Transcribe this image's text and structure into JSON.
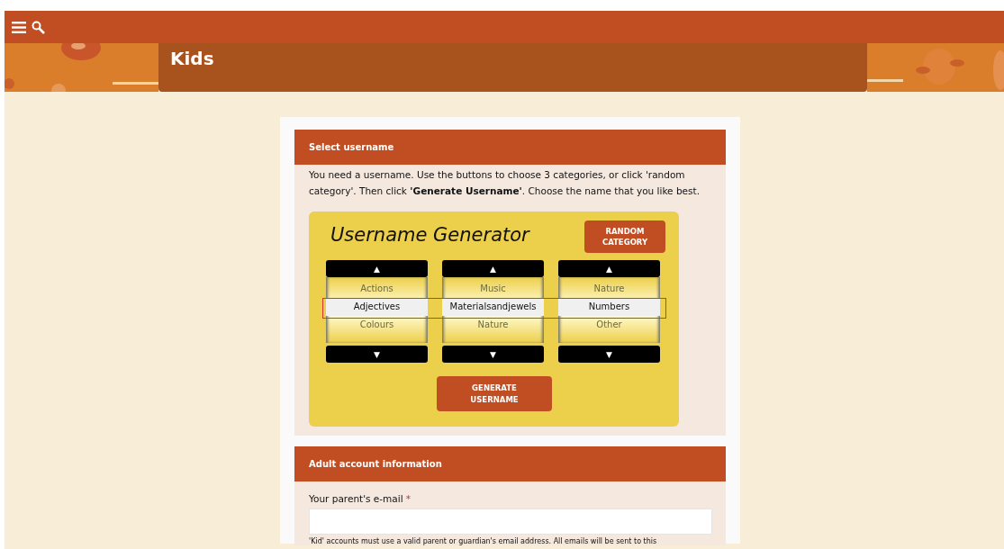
{
  "site_title": "Kids",
  "username_section": {
    "title": "Select username",
    "intro": "You need a username. Use the buttons to choose 3 categories, or click 'random category'. Then click **'Generate Username'**. Choose the name that you like best.",
    "generator": {
      "title": "Username Generator",
      "random_button": "RANDOM CATEGORY",
      "up_label": "▲",
      "down_label": "▼",
      "wheels": [
        {
          "items": [
            {
              "label": "Actions",
              "selected": false
            },
            {
              "label": "Adjectives",
              "selected": true
            },
            {
              "label": "Colours",
              "selected": false
            }
          ]
        },
        {
          "items": [
            {
              "label": "Music",
              "selected": false
            },
            {
              "label": "Materialsandjewels",
              "selected": true
            },
            {
              "label": "Nature",
              "selected": false
            }
          ]
        },
        {
          "items": [
            {
              "label": "Nature",
              "selected": false
            },
            {
              "label": "Numbers",
              "selected": true
            },
            {
              "label": "Other",
              "selected": false
            }
          ]
        }
      ],
      "generate_button": "GENERATE USERNAME"
    }
  },
  "adult_section": {
    "title": "Adult account information",
    "email_label": "Your parent's e-mail",
    "required_mark": "*",
    "help": "'Kid' accounts must use a valid parent or guardian's email address. All emails will be sent to this"
  }
}
